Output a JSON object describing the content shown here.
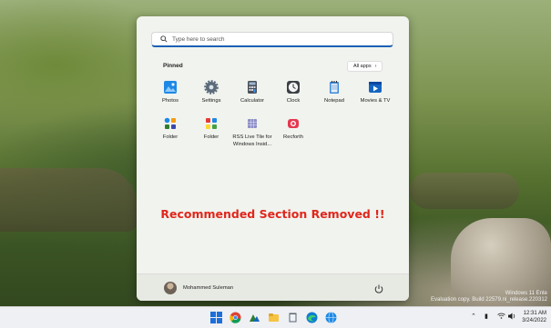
{
  "desktop": {
    "watermark_line1": "Windows 11 Ente",
    "watermark_line2": "Evaluation copy. Build 22579.ni_release.220312"
  },
  "start_menu": {
    "search_placeholder": "Type here to search",
    "pinned_title": "Pinned",
    "all_apps_label": "All apps",
    "pinned_apps": [
      {
        "label": "Photos",
        "icon": "photos-icon"
      },
      {
        "label": "Settings",
        "icon": "gear-icon"
      },
      {
        "label": "Calculator",
        "icon": "calculator-icon"
      },
      {
        "label": "Clock",
        "icon": "clock-icon"
      },
      {
        "label": "Notepad",
        "icon": "notepad-icon"
      },
      {
        "label": "Movies & TV",
        "icon": "movies-icon"
      },
      {
        "label": "Folder",
        "icon": "folder-tile-icon"
      },
      {
        "label": "Folder",
        "icon": "folder-tile-icon"
      },
      {
        "label": "RSS Live Tile for Windows Insid...",
        "icon": "rss-tile-icon"
      },
      {
        "label": "Recforth",
        "icon": "recforth-icon"
      }
    ],
    "recommended_notice": "Recommended Section Removed !!",
    "user_name": "Mohammed Suleman",
    "accent_color": "#1a5fb4",
    "notice_color": "#e0261c"
  },
  "taskbar": {
    "icons": [
      "windows-start-icon",
      "search-icon",
      "widgets-icon",
      "file-explorer-icon",
      "notepad-icon",
      "edge-icon",
      "chrome-icon"
    ],
    "time": "12:31 AM",
    "date": "3/24/2022"
  }
}
